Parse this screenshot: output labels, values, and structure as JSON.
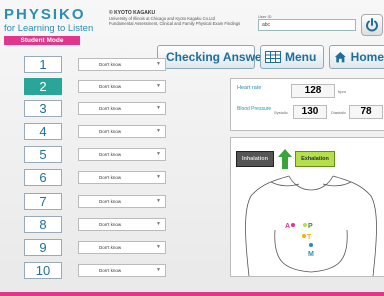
{
  "brand": {
    "title": "PHYSIKO",
    "subtitle": "for Learning to Listen",
    "mode": "Student Mode"
  },
  "copyright": {
    "main": "© KYOTO KAGAKU",
    "line1": "University of Illinois at Chicago and Kyoto Kagaku Co.Ltd",
    "line2": "Fundamental Assessment, Clinical and Family Physical Exam Findings"
  },
  "user": {
    "label": "User ID",
    "value": "abc"
  },
  "toolbar": {
    "check_label": "Checking Answers",
    "menu_label": "Menu",
    "home_label": "Home"
  },
  "rows": [
    {
      "num": "1",
      "answer": "Don't know"
    },
    {
      "num": "2",
      "answer": "Don't know"
    },
    {
      "num": "3",
      "answer": "Don't know"
    },
    {
      "num": "4",
      "answer": "Don't know"
    },
    {
      "num": "5",
      "answer": "Don't know"
    },
    {
      "num": "6",
      "answer": "Don't know"
    },
    {
      "num": "7",
      "answer": "Don't know"
    },
    {
      "num": "8",
      "answer": "Don't know"
    },
    {
      "num": "9",
      "answer": "Don't know"
    },
    {
      "num": "10",
      "answer": "Don't know"
    }
  ],
  "active_row": "2",
  "vitals": {
    "heart_rate_label": "Heart rate",
    "heart_rate": "128",
    "heart_rate_unit": "bpm",
    "bp_label": "Blood Pressure",
    "systolic_label": "Systolic",
    "systolic": "130",
    "diastolic_label": "Diastolic",
    "diastolic": "78"
  },
  "breathing": {
    "inhale_label": "Inhalation",
    "exhale_label": "Exhalation"
  },
  "auscultation": {
    "point_a": "A",
    "point_p": "P",
    "point_t": "T",
    "point_m": "M"
  },
  "colors": {
    "accent_teal": "#2aa59a",
    "brand_blue": "#2b8fb3",
    "pink": "#e0368b",
    "exhale_green": "#b6e04a"
  },
  "icons": {
    "power": "power-icon",
    "check": "checkbox-check-icon",
    "menu": "menu-grid-icon",
    "home": "home-icon",
    "arrow": "arrow-up-icon"
  }
}
